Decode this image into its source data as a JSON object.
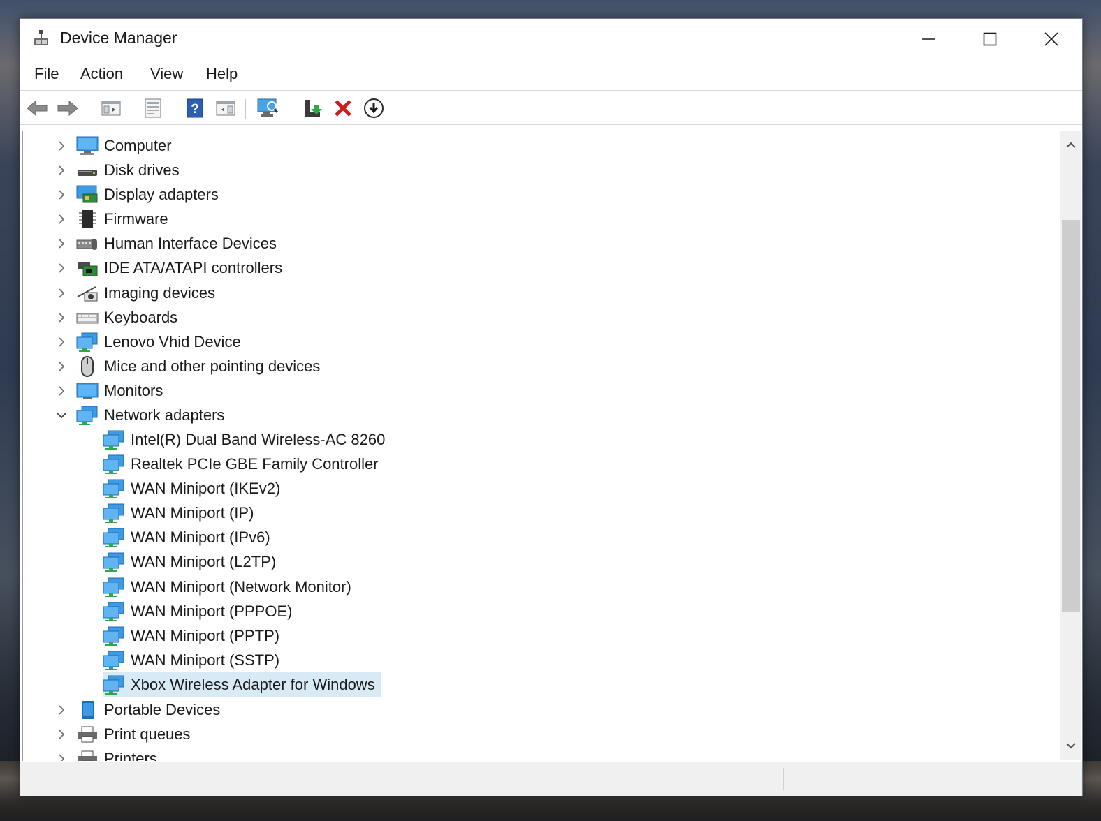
{
  "window": {
    "title": "Device Manager",
    "controls": {
      "minimize_icon": "minimize-icon",
      "maximize_icon": "maximize-icon",
      "close_icon": "close-icon"
    }
  },
  "menu": [
    "File",
    "Action",
    "View",
    "Help"
  ],
  "toolbar": {
    "buttons": [
      "back-arrow-icon",
      "forward-arrow-icon",
      "show-hide-console-tree-icon",
      "properties-icon",
      "help-icon",
      "show-action-pane-icon",
      "scan-for-hardware-changes-icon",
      "update-driver-icon",
      "uninstall-device-icon",
      "disable-device-icon"
    ]
  },
  "tree": {
    "categories": [
      {
        "label": "Computer",
        "icon": "computer-icon",
        "expanded": false
      },
      {
        "label": "Disk drives",
        "icon": "disk-drive-icon",
        "expanded": false
      },
      {
        "label": "Display adapters",
        "icon": "display-adapter-icon",
        "expanded": false
      },
      {
        "label": "Firmware",
        "icon": "firmware-chip-icon",
        "expanded": false
      },
      {
        "label": "Human Interface Devices",
        "icon": "hid-icon",
        "expanded": false
      },
      {
        "label": "IDE ATA/ATAPI controllers",
        "icon": "ide-controller-icon",
        "expanded": false
      },
      {
        "label": "Imaging devices",
        "icon": "camera-icon",
        "expanded": false
      },
      {
        "label": "Keyboards",
        "icon": "keyboard-icon",
        "expanded": false
      },
      {
        "label": "Lenovo Vhid Device",
        "icon": "network-icon",
        "expanded": false
      },
      {
        "label": "Mice and other pointing devices",
        "icon": "mouse-icon",
        "expanded": false
      },
      {
        "label": "Monitors",
        "icon": "monitor-icon",
        "expanded": false
      },
      {
        "label": "Network adapters",
        "icon": "network-icon",
        "expanded": true
      }
    ],
    "network_children": [
      "Intel(R) Dual Band Wireless-AC 8260",
      "Realtek PCIe GBE Family Controller",
      "WAN Miniport (IKEv2)",
      "WAN Miniport (IP)",
      "WAN Miniport (IPv6)",
      "WAN Miniport (L2TP)",
      "WAN Miniport (Network Monitor)",
      "WAN Miniport (PPPOE)",
      "WAN Miniport (PPTP)",
      "WAN Miniport (SSTP)",
      "Xbox Wireless Adapter for Windows"
    ],
    "selected": "Xbox Wireless Adapter for Windows",
    "after": [
      {
        "label": "Portable Devices",
        "icon": "portable-device-icon"
      },
      {
        "label": "Print queues",
        "icon": "printer-icon"
      },
      {
        "label": "Printers",
        "icon": "printer-icon"
      }
    ]
  },
  "colors": {
    "selection": "#d9eaf7",
    "accent": "#1e7fd0",
    "close_red": "#d11a1a"
  }
}
